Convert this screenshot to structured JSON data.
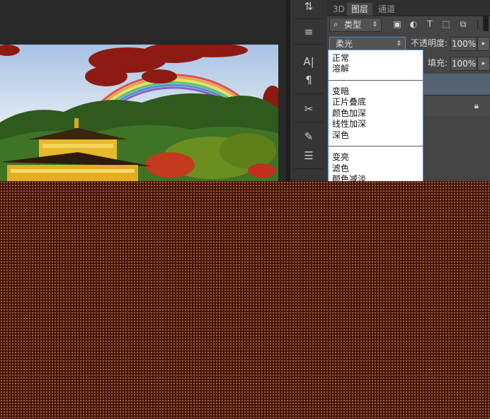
{
  "panel": {
    "tabs": [
      {
        "label": "3D"
      },
      {
        "label": "图层"
      },
      {
        "label": "通道"
      }
    ],
    "filter": {
      "label": "类型",
      "search_icon": "search-icon"
    },
    "filter_icons": [
      "image-filter-icon",
      "adjustment-filter-icon",
      "type-filter-icon",
      "shape-filter-icon",
      "smart-object-filter-icon"
    ],
    "blend_mode": {
      "value": "柔光"
    },
    "opacity": {
      "label": "不透明度:",
      "value": "100%"
    },
    "fill": {
      "label": "填充:",
      "value": "100%"
    },
    "lock_icon": "lock-icon"
  },
  "blend_menu": {
    "groups": [
      [
        "正常",
        "溶解"
      ],
      [
        "变暗",
        "正片叠底",
        "颜色加深",
        "线性加深",
        "深色"
      ],
      [
        "变亮",
        "滤色",
        "颜色减淡"
      ]
    ]
  },
  "colors": {
    "overlay": "#4a1504",
    "panel": "#454545",
    "menu_border": "#4b8ccf"
  }
}
